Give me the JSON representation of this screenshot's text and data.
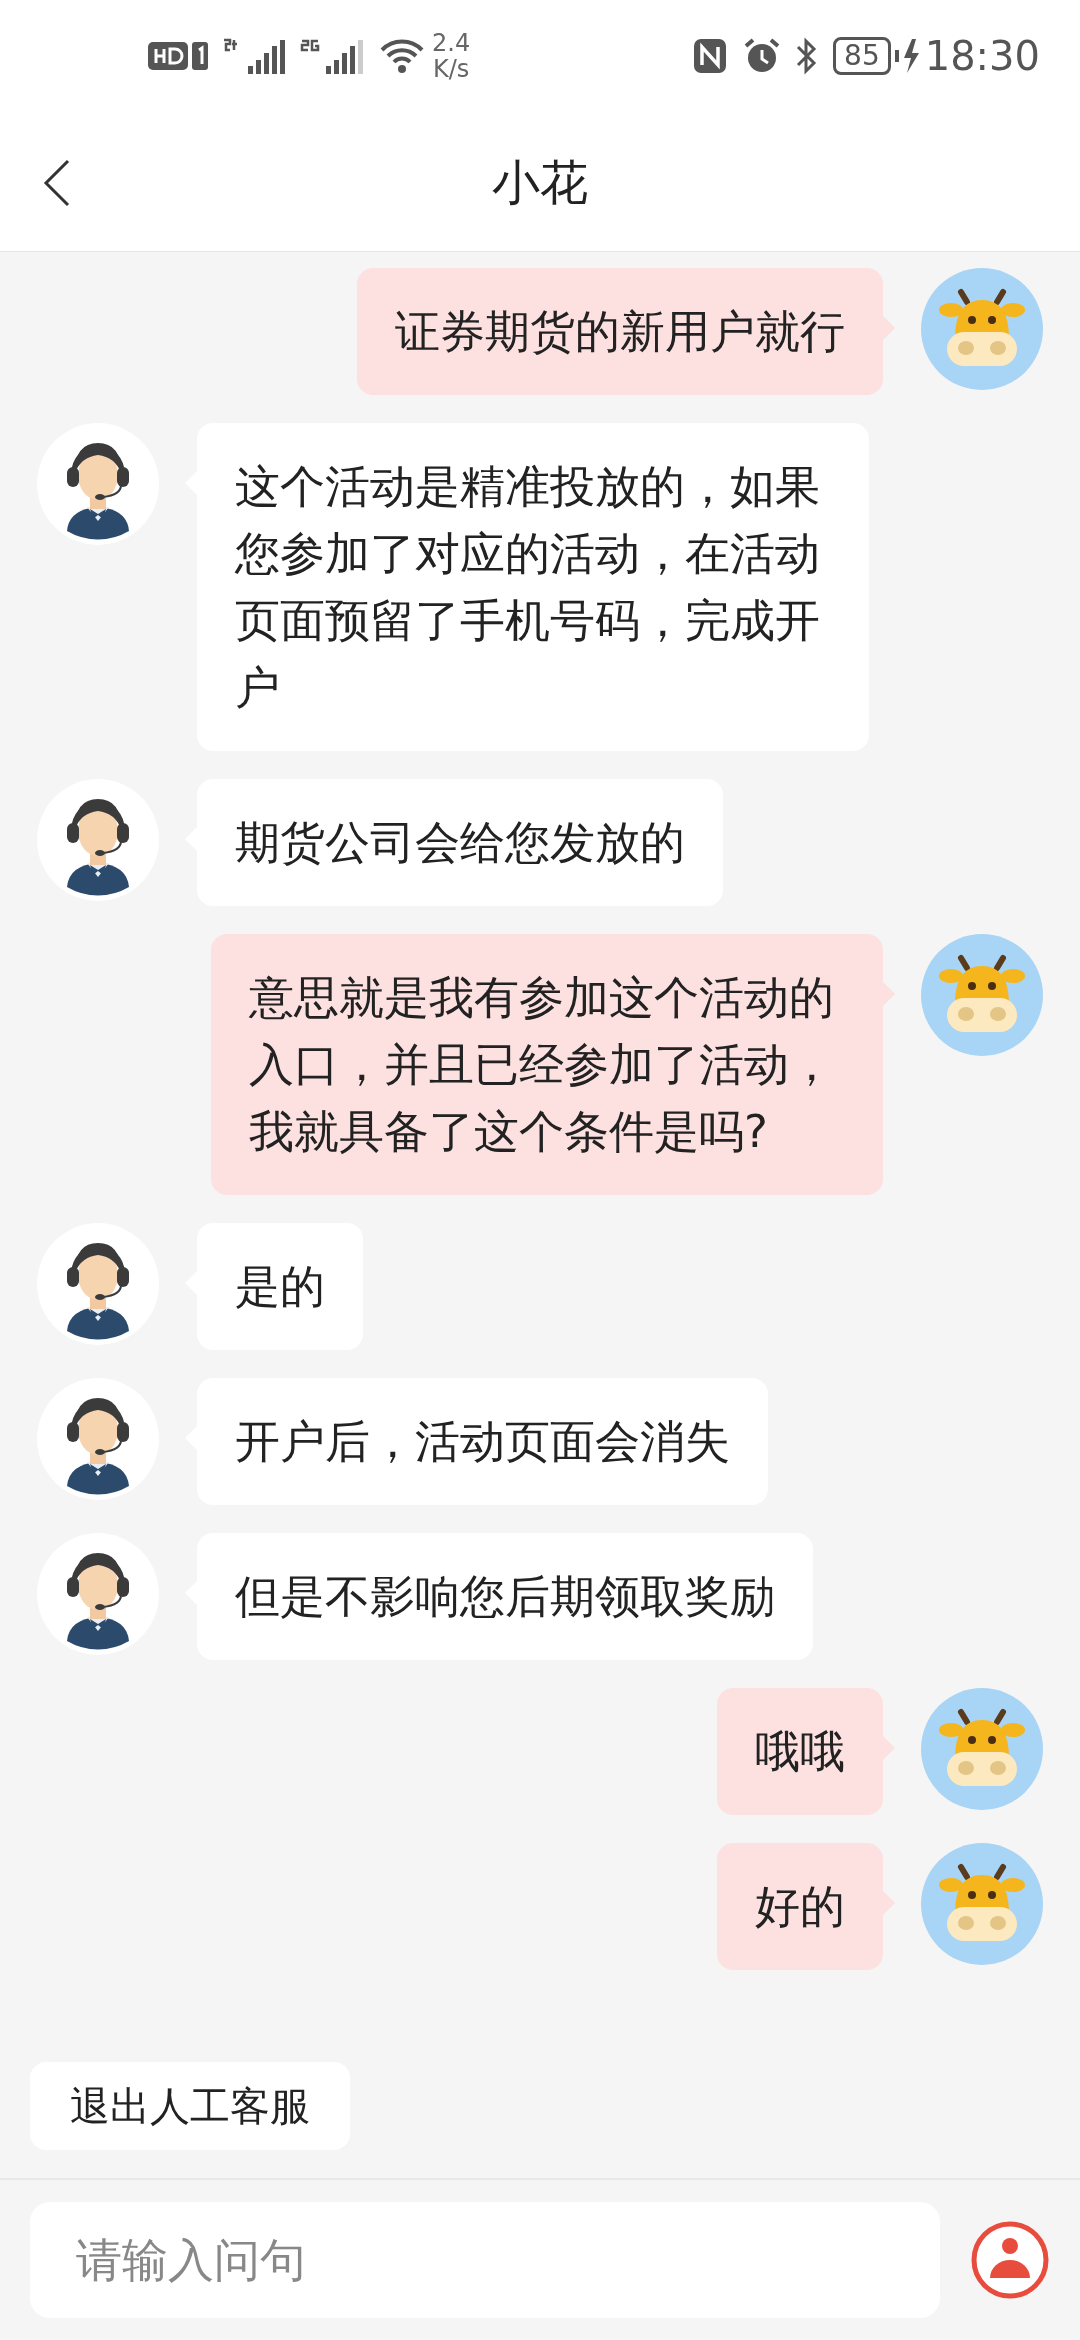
{
  "status_bar": {
    "speed_value": "2.4",
    "speed_unit": "K/s",
    "battery": "85",
    "time": "18:30"
  },
  "header": {
    "title": "小花"
  },
  "messages": [
    {
      "kind": "outgoing",
      "text": "证券期货的新用户就行"
    },
    {
      "kind": "incoming",
      "text": "这个活动是精准投放的，如果您参加了对应的活动，在活动页面预留了手机号码，完成开户"
    },
    {
      "kind": "incoming",
      "text": "期货公司会给您发放的"
    },
    {
      "kind": "outgoing",
      "text": "意思就是我有参加这个活动的入口，并且已经参加了活动，我就具备了这个条件是吗?"
    },
    {
      "kind": "incoming",
      "text": "是的"
    },
    {
      "kind": "incoming",
      "text": "开户后，活动页面会消失"
    },
    {
      "kind": "incoming",
      "text": "但是不影响您后期领取奖励"
    },
    {
      "kind": "outgoing",
      "text": "哦哦"
    },
    {
      "kind": "outgoing",
      "text": "好的"
    }
  ],
  "exit_button": {
    "label": "退出人工客服"
  },
  "input": {
    "placeholder": "请输入问句"
  }
}
